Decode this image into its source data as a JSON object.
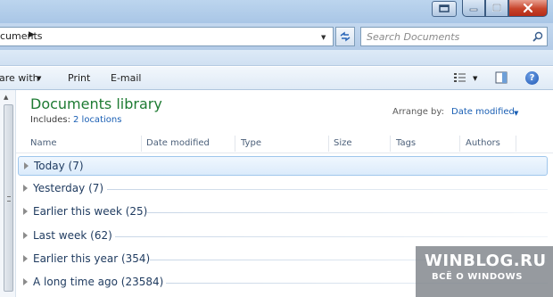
{
  "window": {
    "caption_buttons": [
      "minimize-icon",
      "maximize-icon",
      "close-icon"
    ]
  },
  "address": {
    "path_text": "cuments",
    "search_placeholder": "Search Documents"
  },
  "toolbar": {
    "share_label": "are with",
    "print_label": "Print",
    "email_label": "E-mail"
  },
  "library": {
    "title": "Documents library",
    "includes_label": "Includes:",
    "locations_link": "2 locations",
    "arrange_label": "Arrange by:",
    "arrange_value": "Date modified"
  },
  "columns": {
    "name": "Name",
    "date_modified": "Date modified",
    "type": "Type",
    "size": "Size",
    "tags": "Tags",
    "authors": "Authors"
  },
  "groups": [
    {
      "label": "Today (7)"
    },
    {
      "label": "Yesterday (7)"
    },
    {
      "label": "Earlier this week (25)"
    },
    {
      "label": "Last week (62)"
    },
    {
      "label": "Earlier this year (354)"
    },
    {
      "label": "A long time ago (23584)"
    }
  ],
  "selected_group": "Today (7)",
  "watermark": {
    "main": "WINBLOG.RU",
    "sub": "ВСЁ О WINDOWS"
  },
  "colors": {
    "title_green": "#1e7b33",
    "link_blue": "#1a5fb4",
    "chrome_blue": "#b3cbe7"
  }
}
